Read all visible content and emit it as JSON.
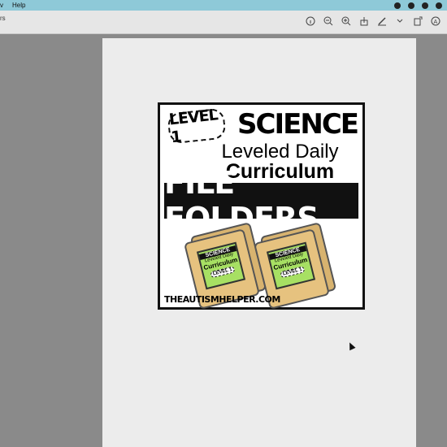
{
  "menubar": {
    "partial_item": "v",
    "help": "Help"
  },
  "toolbar": {
    "partial_title": "rs"
  },
  "cover": {
    "level": "LEVEL 1",
    "subject": "SCIENCE",
    "line1": "Leveled Daily",
    "line2": "Curriculum",
    "banner": "FILE FOLDERS",
    "folder_subject": "SCIENCE",
    "folder_line1": "Leveled Daily",
    "folder_line2": "Curriculum",
    "folder_level": "LEVEL 1",
    "website": "THEAUTISMHELPER.COM"
  }
}
